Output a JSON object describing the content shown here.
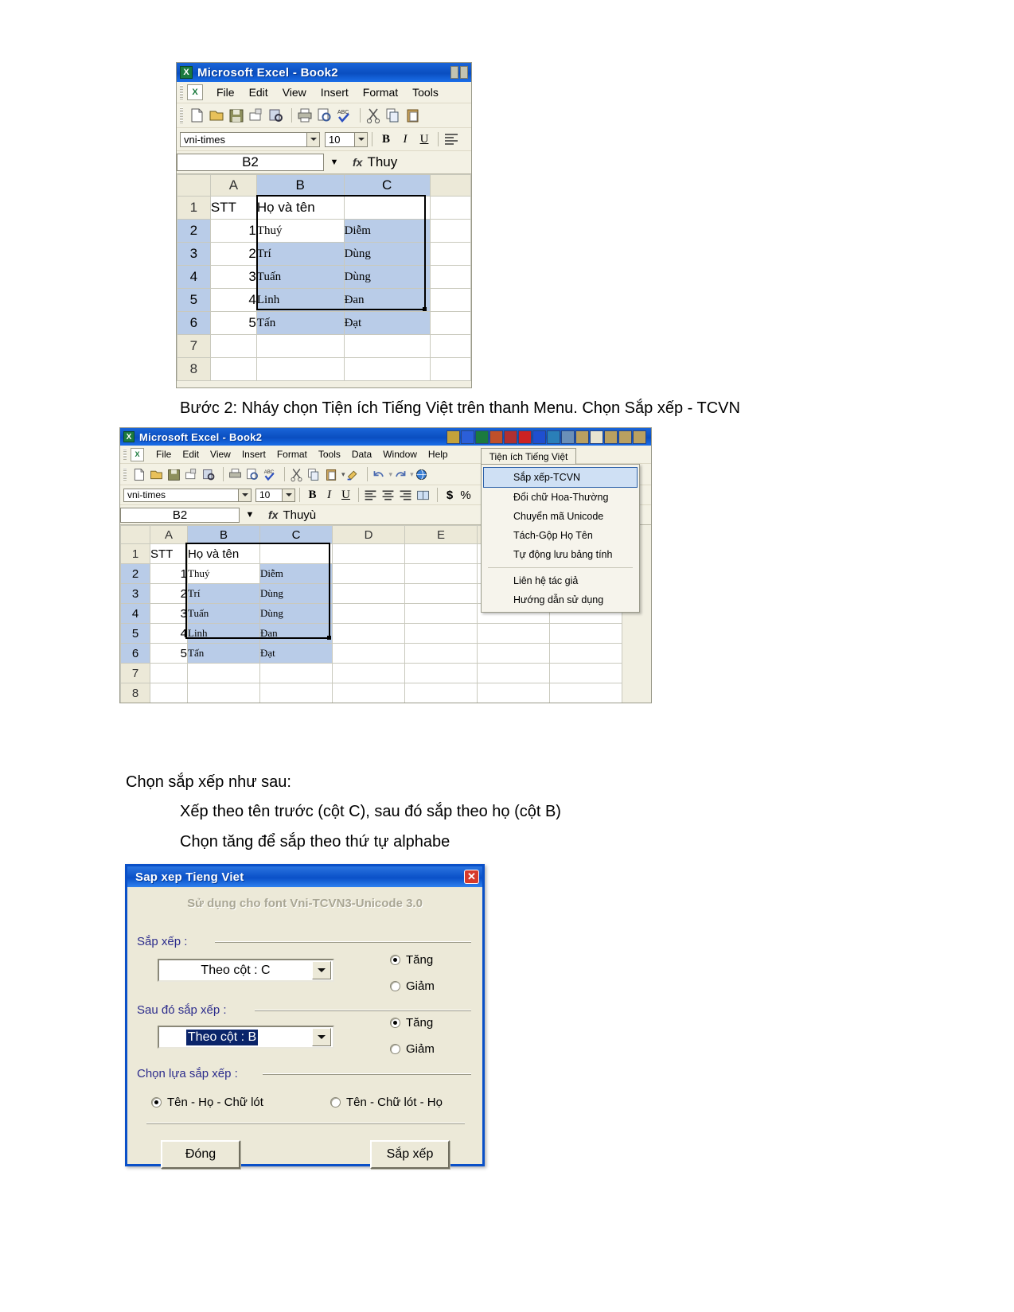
{
  "excel1": {
    "title": "Microsoft Excel - Book2",
    "app_icon": "excel-icon",
    "menus": [
      "File",
      "Edit",
      "View",
      "Insert",
      "Format",
      "Tools"
    ],
    "font_name": "vni-times",
    "font_size": "10",
    "bold": "B",
    "italic": "I",
    "underline": "U",
    "name_box": "B2",
    "fx": "fx",
    "formula": "Thuy",
    "columns": [
      "",
      "A",
      "B",
      "C",
      ""
    ],
    "rows": [
      {
        "n": "1",
        "a": "STT",
        "b": "Họ và tên",
        "c": ""
      },
      {
        "n": "2",
        "a": "1",
        "b": "Thuý",
        "c": "Diễm"
      },
      {
        "n": "3",
        "a": "2",
        "b": "Trí",
        "c": "Dùng"
      },
      {
        "n": "4",
        "a": "3",
        "b": "Tuấn",
        "c": "Dùng"
      },
      {
        "n": "5",
        "a": "4",
        "b": "Linh",
        "c": "Đan"
      },
      {
        "n": "6",
        "a": "5",
        "b": "Tấn",
        "c": "Đạt"
      },
      {
        "n": "7",
        "a": "",
        "b": "",
        "c": ""
      },
      {
        "n": "8",
        "a": "",
        "b": "",
        "c": ""
      }
    ]
  },
  "caption1": "Bước 2: Nháy chọn Tiện ích Tiếng Việt trên thanh Menu. Chọn Sắp xếp - TCVN",
  "excel2": {
    "title": "Microsoft Excel - Book2",
    "menus": [
      "File",
      "Edit",
      "View",
      "Insert",
      "Format",
      "Tools",
      "Data",
      "Window",
      "Help"
    ],
    "vn_menu_title": "Tiện ích Tiếng Việt",
    "font_name": "vni-times",
    "font_size": "10",
    "bold": "B",
    "italic": "I",
    "underline": "U",
    "currency": "$",
    "percent": "%",
    "name_box": "B2",
    "fx": "fx",
    "formula": "Thuyù",
    "columns": [
      "",
      "A",
      "B",
      "C",
      "D",
      "E",
      ""
    ],
    "rows": [
      {
        "n": "1",
        "a": "STT",
        "b": "Họ và tên",
        "c": ""
      },
      {
        "n": "2",
        "a": "1",
        "b": "Thuý",
        "c": "Diễm"
      },
      {
        "n": "3",
        "a": "2",
        "b": "Trí",
        "c": "Dùng"
      },
      {
        "n": "4",
        "a": "3",
        "b": "Tuấn",
        "c": "Dùng"
      },
      {
        "n": "5",
        "a": "4",
        "b": "Linh",
        "c": "Đan"
      },
      {
        "n": "6",
        "a": "5",
        "b": "Tấn",
        "c": "Đạt"
      },
      {
        "n": "7",
        "a": "",
        "b": "",
        "c": ""
      },
      {
        "n": "8",
        "a": "",
        "b": "",
        "c": ""
      }
    ],
    "dropdown_items": [
      "Sắp xếp-TCVN",
      "Đổi chữ Hoa-Thường",
      "Chuyển mã Unicode",
      "Tách-Gộp Họ Tên",
      "Tự động lưu bảng tính",
      "Liên hệ tác giả",
      "Hướng dẫn sử dụng"
    ],
    "highlighted_item": "Sắp xếp-TCVN"
  },
  "body_text": {
    "line1": "Chọn sắp xếp như sau:",
    "line2": "Xếp theo tên trước (cột C), sau đó sắp theo họ (cột B)",
    "line3": "Chọn tăng để sắp theo thứ tự alphabe"
  },
  "dialog": {
    "title": "Sap xep Tieng Viet",
    "close_label": "✕",
    "subtitle": "Sử dụng cho font Vni-TCVN3-Unicode 3.0",
    "group1_label": "Sắp xếp :",
    "group1_value": "Theo cột : C",
    "group1_asc": "Tăng",
    "group1_desc": "Giảm",
    "group1_selected": "Tăng",
    "group2_label": "Sau đó sắp xếp :",
    "group2_value": "Theo cột : B",
    "group2_asc": "Tăng",
    "group2_desc": "Giảm",
    "group2_selected": "Tăng",
    "group3_label": "Chọn lựa sắp xếp :",
    "option1": "Tên - Họ - Chữ lót",
    "option2": "Tên - Chữ lót - Họ",
    "option_selected": "Tên - Họ - Chữ lót",
    "btn_close": "Đóng",
    "btn_sort": "Sắp xếp",
    "accent_color": "#0a50c8",
    "label_color": "#2c2c8c"
  }
}
